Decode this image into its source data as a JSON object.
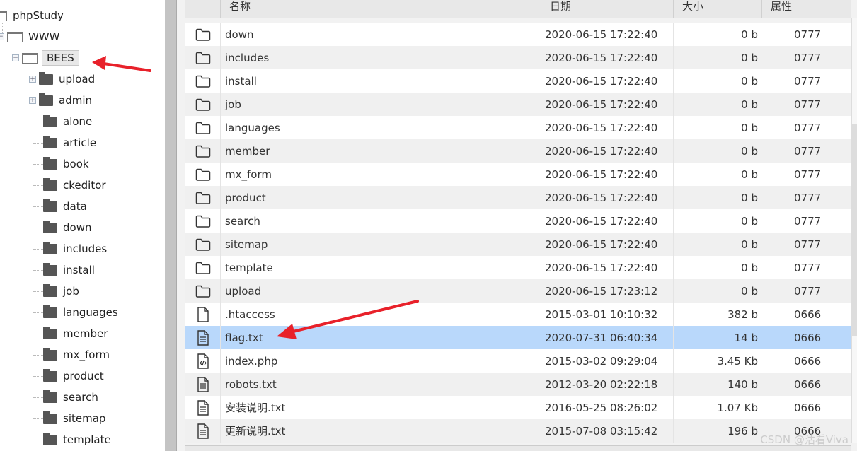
{
  "tree": {
    "root": "phpStudy",
    "www": "WWW",
    "selected": "BEES",
    "children": [
      {
        "label": "upload",
        "expandable": true
      },
      {
        "label": "admin",
        "expandable": true
      },
      {
        "label": "alone"
      },
      {
        "label": "article"
      },
      {
        "label": "book"
      },
      {
        "label": "ckeditor"
      },
      {
        "label": "data"
      },
      {
        "label": "down"
      },
      {
        "label": "includes"
      },
      {
        "label": "install"
      },
      {
        "label": "job"
      },
      {
        "label": "languages"
      },
      {
        "label": "member"
      },
      {
        "label": "mx_form"
      },
      {
        "label": "product"
      },
      {
        "label": "search"
      },
      {
        "label": "sitemap"
      },
      {
        "label": "template"
      }
    ]
  },
  "table": {
    "headers": [
      "名称",
      "日期",
      "大小",
      "属性"
    ],
    "rows": [
      {
        "icon": "folder",
        "name": "down",
        "date": "2020-06-15 17:22:40",
        "size": "0 b",
        "attr": "0777"
      },
      {
        "icon": "folder",
        "name": "includes",
        "date": "2020-06-15 17:22:40",
        "size": "0 b",
        "attr": "0777"
      },
      {
        "icon": "folder",
        "name": "install",
        "date": "2020-06-15 17:22:40",
        "size": "0 b",
        "attr": "0777"
      },
      {
        "icon": "folder",
        "name": "job",
        "date": "2020-06-15 17:22:40",
        "size": "0 b",
        "attr": "0777"
      },
      {
        "icon": "folder",
        "name": "languages",
        "date": "2020-06-15 17:22:40",
        "size": "0 b",
        "attr": "0777"
      },
      {
        "icon": "folder",
        "name": "member",
        "date": "2020-06-15 17:22:40",
        "size": "0 b",
        "attr": "0777"
      },
      {
        "icon": "folder",
        "name": "mx_form",
        "date": "2020-06-15 17:22:40",
        "size": "0 b",
        "attr": "0777"
      },
      {
        "icon": "folder",
        "name": "product",
        "date": "2020-06-15 17:22:40",
        "size": "0 b",
        "attr": "0777"
      },
      {
        "icon": "folder",
        "name": "search",
        "date": "2020-06-15 17:22:40",
        "size": "0 b",
        "attr": "0777"
      },
      {
        "icon": "folder",
        "name": "sitemap",
        "date": "2020-06-15 17:22:40",
        "size": "0 b",
        "attr": "0777"
      },
      {
        "icon": "folder",
        "name": "template",
        "date": "2020-06-15 17:22:40",
        "size": "0 b",
        "attr": "0777"
      },
      {
        "icon": "folder",
        "name": "upload",
        "date": "2020-06-15 17:23:12",
        "size": "0 b",
        "attr": "0777"
      },
      {
        "icon": "file",
        "name": ".htaccess",
        "date": "2015-03-01 10:10:32",
        "size": "382 b",
        "attr": "0666"
      },
      {
        "icon": "text",
        "name": "flag.txt",
        "date": "2020-07-31 06:40:34",
        "size": "14 b",
        "attr": "0666",
        "selected": true
      },
      {
        "icon": "code",
        "name": "index.php",
        "date": "2015-03-02 09:29:04",
        "size": "3.45 Kb",
        "attr": "0666"
      },
      {
        "icon": "text",
        "name": "robots.txt",
        "date": "2012-03-20 02:22:18",
        "size": "140 b",
        "attr": "0666"
      },
      {
        "icon": "text",
        "name": "安装说明.txt",
        "date": "2016-05-25 08:26:02",
        "size": "1.07 Kb",
        "attr": "0666"
      },
      {
        "icon": "text",
        "name": "更新说明.txt",
        "date": "2015-07-08 03:15:42",
        "size": "196 b",
        "attr": "0666"
      }
    ]
  },
  "watermark": "CSDN @沽看Viva",
  "colors": {
    "selected_row": "#b9d8fb",
    "arrow": "#e8212a"
  }
}
